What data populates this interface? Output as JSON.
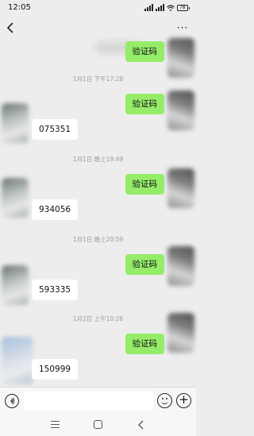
{
  "status_bar": {
    "time": "12:05",
    "battery": "78"
  },
  "header": {
    "more_label": "···"
  },
  "messages": [
    {
      "type": "sent",
      "text": "验证码"
    },
    {
      "type": "time",
      "text": "1月1日 下午17:28"
    },
    {
      "type": "sent",
      "text": "验证码"
    },
    {
      "type": "recv",
      "text": "075351"
    },
    {
      "type": "time",
      "text": "1月1日 晚上19:49"
    },
    {
      "type": "sent",
      "text": "验证码"
    },
    {
      "type": "recv",
      "text": "934056"
    },
    {
      "type": "time",
      "text": "1月1日 晚上20:59"
    },
    {
      "type": "sent",
      "text": "验证码"
    },
    {
      "type": "recv",
      "text": "593335"
    },
    {
      "type": "time",
      "text": "1月2日 上午10:26"
    },
    {
      "type": "sent",
      "text": "验证码"
    },
    {
      "type": "recv",
      "text": "150999"
    }
  ],
  "input_bar": {
    "placeholder": "",
    "plus_label": "+"
  },
  "icons": {
    "back": "chevron-left-icon",
    "more": "more-dots-icon",
    "voice": "voice-icon",
    "emoji": "emoji-icon",
    "plus": "plus-icon"
  },
  "colors": {
    "sent_bubble": "#95ec69",
    "recv_bubble": "#ffffff",
    "background": "#ededed"
  }
}
